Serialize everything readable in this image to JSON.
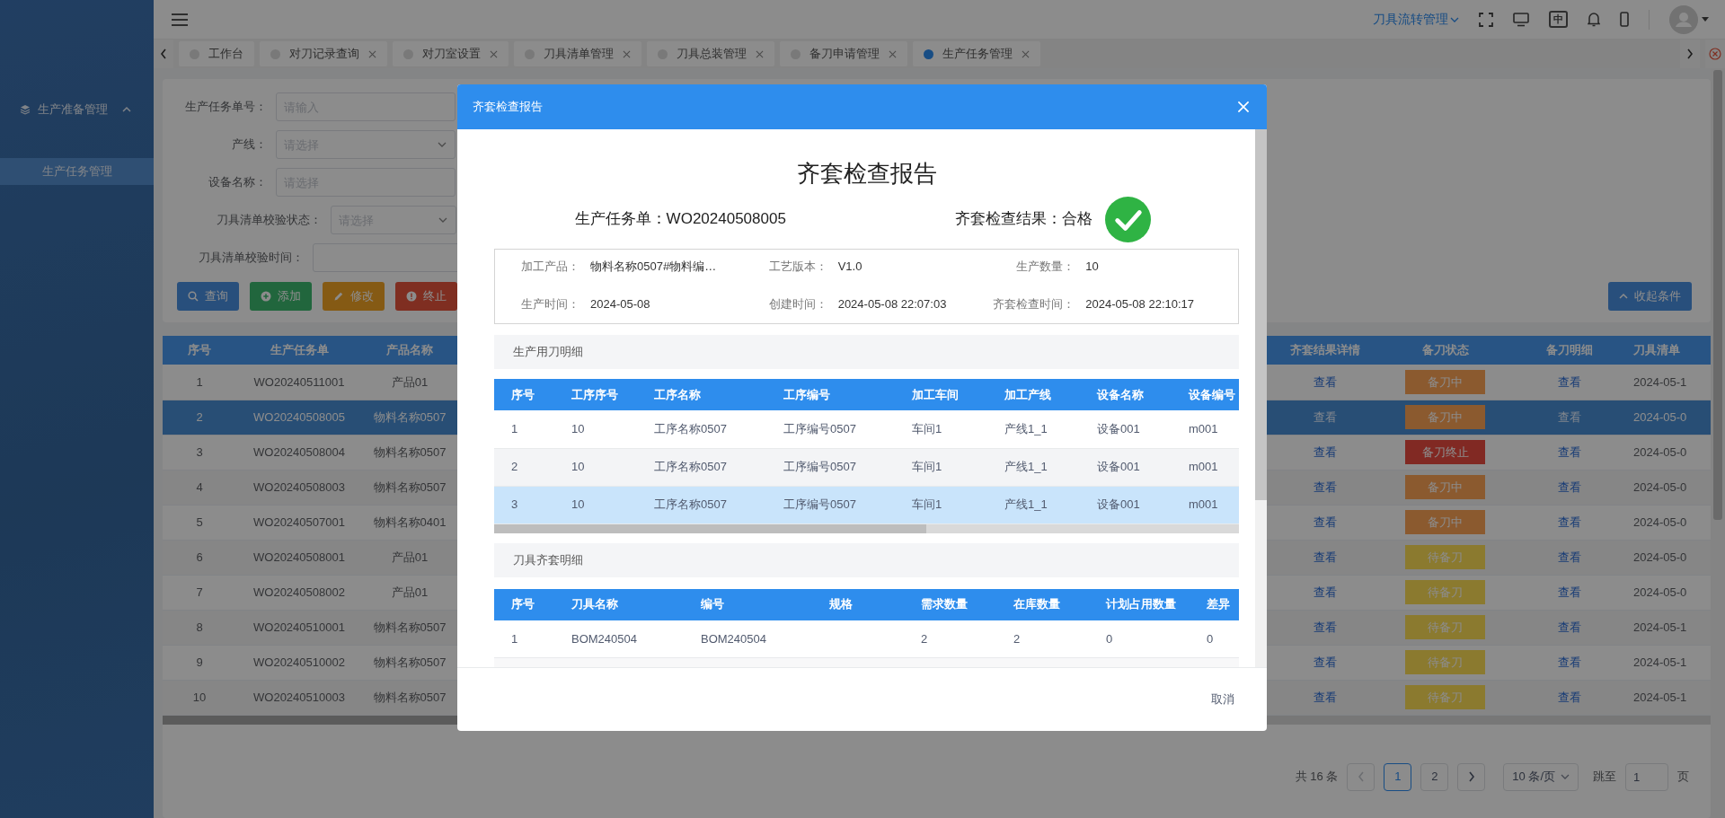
{
  "header": {
    "menu_link": "刀具流转管理",
    "lang_label": "中"
  },
  "sidebar": {
    "items": [
      {
        "label": "生产准备管理",
        "kind": "group",
        "expanded": true
      },
      {
        "label": "生产任务管理",
        "kind": "item",
        "selected": true
      }
    ]
  },
  "tabs": [
    {
      "label": "工作台",
      "closable": false,
      "selected": false
    },
    {
      "label": "对刀记录查询",
      "closable": true,
      "selected": false
    },
    {
      "label": "对刀室设置",
      "closable": true,
      "selected": false
    },
    {
      "label": "刀具清单管理",
      "closable": true,
      "selected": false
    },
    {
      "label": "刀具总装管理",
      "closable": true,
      "selected": false
    },
    {
      "label": "备刀申请管理",
      "closable": true,
      "selected": false
    },
    {
      "label": "生产任务管理",
      "closable": true,
      "selected": true
    }
  ],
  "filters": [
    {
      "label": "生产任务单号：",
      "kind": "input",
      "placeholder": "请输入"
    },
    {
      "label": "产线：",
      "kind": "select",
      "placeholder": "请选择"
    },
    {
      "label": "设备名称：",
      "kind": "input",
      "placeholder": "请选择"
    },
    {
      "label": "刀具清单校验状态：",
      "kind": "select",
      "placeholder": "请选择"
    },
    {
      "label": "刀具清单校验时间：",
      "kind": "input"
    }
  ],
  "actions": [
    {
      "label": "查询",
      "kind": "search"
    },
    {
      "label": "添加",
      "kind": "add"
    },
    {
      "label": "修改",
      "kind": "edit"
    },
    {
      "label": "终止",
      "kind": "stop"
    }
  ],
  "collapse_button": "收起条件",
  "task_table": {
    "columns": [
      "序号",
      "生产任务单",
      "产品名称",
      "齐套结果详情",
      "备刀状态",
      "备刀明细",
      "刀具清单"
    ],
    "rows": [
      {
        "seq": "1",
        "order": "WO20240511001",
        "product": "产品01",
        "result_link": "查看",
        "status": {
          "label": "备刀中",
          "color": "#8b5a30"
        },
        "detail_link": "查看",
        "list_date": "2024-05-1",
        "selected": false
      },
      {
        "seq": "2",
        "order": "WO20240508005",
        "product": "物料名称0507",
        "result_link": "查看",
        "status": {
          "label": "备刀中",
          "color": "#8b5a30"
        },
        "detail_link": "查看",
        "list_date": "2024-05-0",
        "selected": true
      },
      {
        "seq": "3",
        "order": "WO20240508004",
        "product": "物料名称0507",
        "result_link": "查看",
        "status": {
          "label": "备刀终止",
          "color": "#822a23"
        },
        "detail_link": "查看",
        "list_date": "2024-05-0",
        "selected": false
      },
      {
        "seq": "4",
        "order": "WO20240508003",
        "product": "物料名称0507",
        "result_link": "查看",
        "status": {
          "label": "备刀中",
          "color": "#8b5a30"
        },
        "detail_link": "查看",
        "list_date": "2024-05-0",
        "selected": false
      },
      {
        "seq": "5",
        "order": "WO20240507001",
        "product": "物料名称0401",
        "result_link": "查看",
        "status": {
          "label": "备刀中",
          "color": "#8b5a30"
        },
        "detail_link": "查看",
        "list_date": "2024-05-0",
        "selected": false
      },
      {
        "seq": "6",
        "order": "WO20240508001",
        "product": "产品01",
        "result_link": "查看",
        "status": {
          "label": "待备刀",
          "color": "#8b7a30"
        },
        "detail_link": "查看",
        "list_date": "2024-05-0",
        "selected": false
      },
      {
        "seq": "7",
        "order": "WO20240508002",
        "product": "产品01",
        "result_link": "查看",
        "status": {
          "label": "待备刀",
          "color": "#8b7a30"
        },
        "detail_link": "查看",
        "list_date": "2024-05-0",
        "selected": false
      },
      {
        "seq": "8",
        "order": "WO20240510001",
        "product": "物料名称0507",
        "result_link": "查看",
        "status": {
          "label": "待备刀",
          "color": "#8b7a30"
        },
        "detail_link": "查看",
        "list_date": "2024-05-1",
        "selected": false
      },
      {
        "seq": "9",
        "order": "WO20240510002",
        "product": "物料名称0507",
        "result_link": "查看",
        "status": {
          "label": "待备刀",
          "color": "#8b7a30"
        },
        "detail_link": "查看",
        "list_date": "2024-05-1",
        "selected": false
      },
      {
        "seq": "10",
        "order": "WO20240510003",
        "product": "物料名称0507",
        "result_link": "查看",
        "status": {
          "label": "待备刀",
          "color": "#8b7a30"
        },
        "detail_link": "查看",
        "list_date": "2024-05-1",
        "selected": false
      }
    ]
  },
  "pagination": {
    "total": "共 16 条",
    "prev_disabled": true,
    "next_disabled": false,
    "pages": [
      {
        "label": "1",
        "selected": true
      },
      {
        "label": "2",
        "selected": false
      }
    ],
    "page_size": "10 条/页",
    "jump_label": "跳至",
    "jump_value": "1",
    "page_suffix": "页"
  },
  "dialog": {
    "title": "齐套检查报告",
    "heading": "齐套检查报告",
    "task": "生产任务单：WO20240508005",
    "result": "齐套检查结果：合格",
    "passed": true,
    "info": [
      {
        "label": "加工产品：",
        "value": "物料名称0507#物料编…"
      },
      {
        "label": "工艺版本：",
        "value": "V1.0"
      },
      {
        "label": "生产数量：",
        "value": "10"
      },
      {
        "label": "生产时间：",
        "value": "2024-05-08"
      },
      {
        "label": "创建时间：",
        "value": "2024-05-08 22:07:03"
      },
      {
        "label": "齐套检查时间：",
        "value": "2024-05-08 22:10:17"
      }
    ],
    "usage_section": "生产用刀明细",
    "usage_table": {
      "columns": [
        "序号",
        "工序序号",
        "工序名称",
        "工序编号",
        "加工车间",
        "加工产线",
        "设备名称",
        "设备编号"
      ],
      "rows": [
        {
          "cells": [
            "1",
            "10",
            "工序名称0507",
            "工序编号0507",
            "车间1",
            "产线1_1",
            "设备001",
            "m001"
          ],
          "selected": false
        },
        {
          "cells": [
            "2",
            "10",
            "工序名称0507",
            "工序编号0507",
            "车间1",
            "产线1_1",
            "设备001",
            "m001"
          ],
          "selected": false
        },
        {
          "cells": [
            "3",
            "10",
            "工序名称0507",
            "工序编号0507",
            "车间1",
            "产线1_1",
            "设备001",
            "m001"
          ],
          "selected": true
        }
      ]
    },
    "kit_section": "刀具齐套明细",
    "kit_table": {
      "columns": [
        "序号",
        "刀具名称",
        "编号",
        "规格",
        "需求数量",
        "在库数量",
        "计划占用数量",
        "差异"
      ],
      "rows": [
        {
          "cells": [
            "1",
            "BOM240504",
            "BOM240504",
            "",
            "2",
            "2",
            "0",
            "0"
          ],
          "selected": false
        }
      ]
    },
    "cancel": "取消"
  }
}
